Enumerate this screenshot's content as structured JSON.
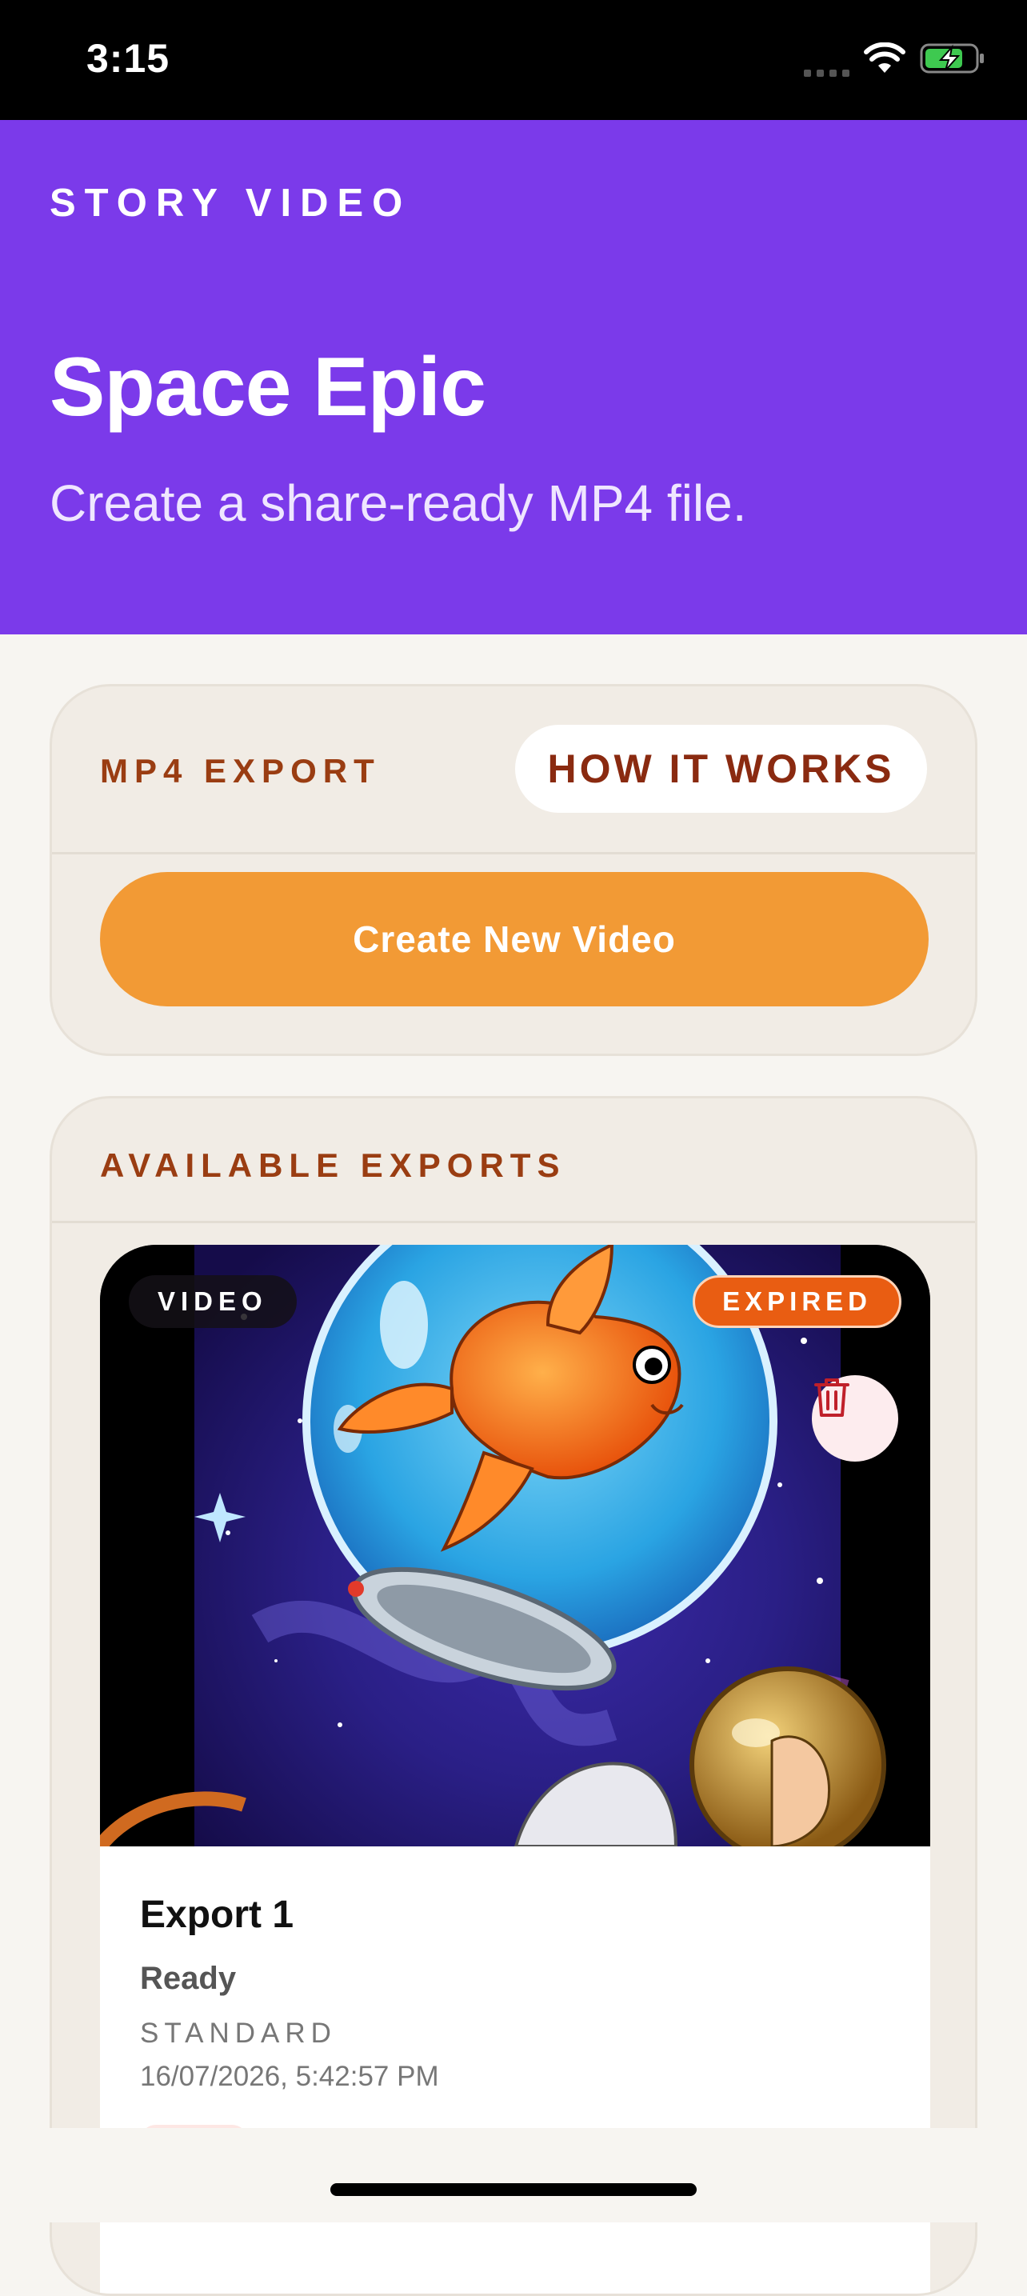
{
  "status_bar": {
    "time": "3:15"
  },
  "header": {
    "kicker": "STORY VIDEO",
    "title": "Space Epic",
    "subtitle": "Create a share-ready MP4 file.",
    "background": "#7b3aea"
  },
  "export_card": {
    "label": "MP4 EXPORT",
    "how_it_works_label": "HOW IT WORKS",
    "create_button_label": "Create New Video",
    "accent": "#f29a35"
  },
  "available_card": {
    "label": "AVAILABLE EXPORTS",
    "exports": [
      {
        "type_badge": "VIDEO",
        "status_badge": "EXPIRED",
        "name": "Export 1",
        "state": "Ready",
        "quality": "STANDARD",
        "date": "16/07/2026, 5:42:57 PM",
        "thumbnail": "goldfish-in-space-helmet-illustration"
      }
    ]
  },
  "icons": [
    "wifi-icon",
    "battery-charging-icon",
    "trash-icon"
  ]
}
